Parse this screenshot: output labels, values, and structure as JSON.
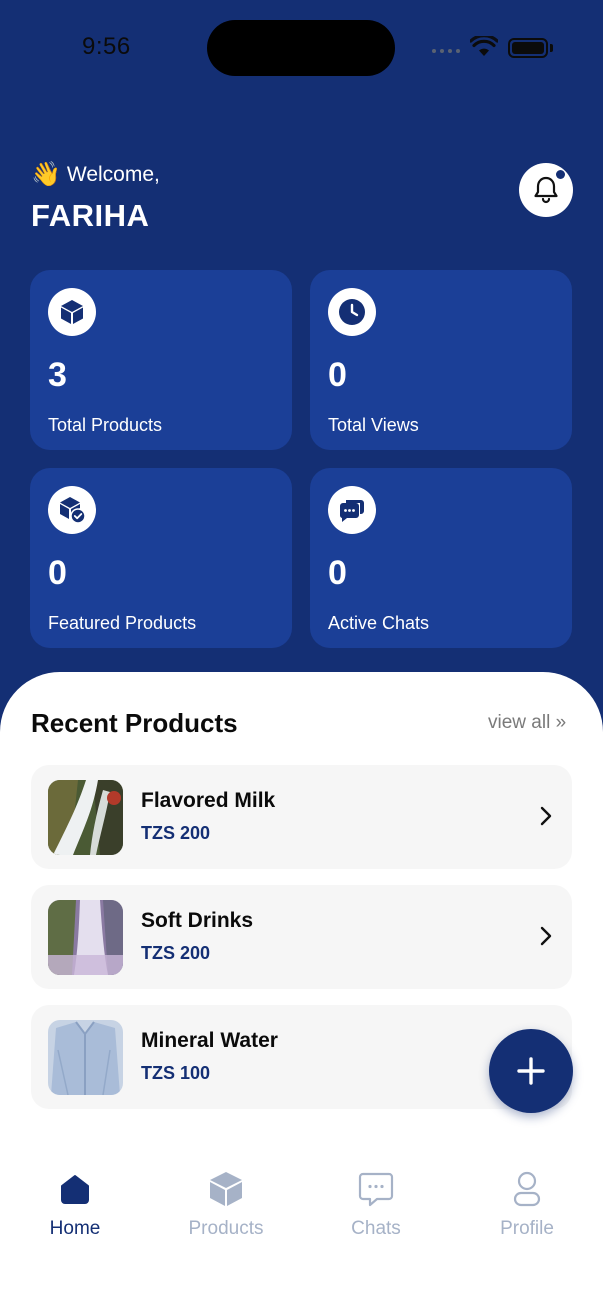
{
  "status_bar": {
    "time": "9:56"
  },
  "header": {
    "greeting_emoji": "👋",
    "greeting": "Welcome,",
    "user_name": "FARIHA"
  },
  "stats": [
    {
      "value": "3",
      "label": "Total Products",
      "icon": "cube-icon"
    },
    {
      "value": "0",
      "label": "Total Views",
      "icon": "clock-icon"
    },
    {
      "value": "0",
      "label": "Featured Products",
      "icon": "featured-box-icon"
    },
    {
      "value": "0",
      "label": "Active Chats",
      "icon": "chat-bubbles-icon"
    }
  ],
  "recent": {
    "title": "Recent Products",
    "view_all": "view all »",
    "items": [
      {
        "name": "Flavored Milk",
        "price": "TZS 200"
      },
      {
        "name": "Soft Drinks",
        "price": "TZS 200"
      },
      {
        "name": "Mineral Water",
        "price": "TZS 100"
      }
    ]
  },
  "nav": [
    {
      "label": "Home",
      "icon": "home-icon",
      "active": true
    },
    {
      "label": "Products",
      "icon": "box-icon",
      "active": false
    },
    {
      "label": "Chats",
      "icon": "chat-icon",
      "active": false
    },
    {
      "label": "Profile",
      "icon": "person-icon",
      "active": false
    }
  ],
  "colors": {
    "primary": "#142f74",
    "card": "#1b3f97",
    "inactive_nav": "#a6b2c7",
    "sheet": "#ffffff"
  }
}
